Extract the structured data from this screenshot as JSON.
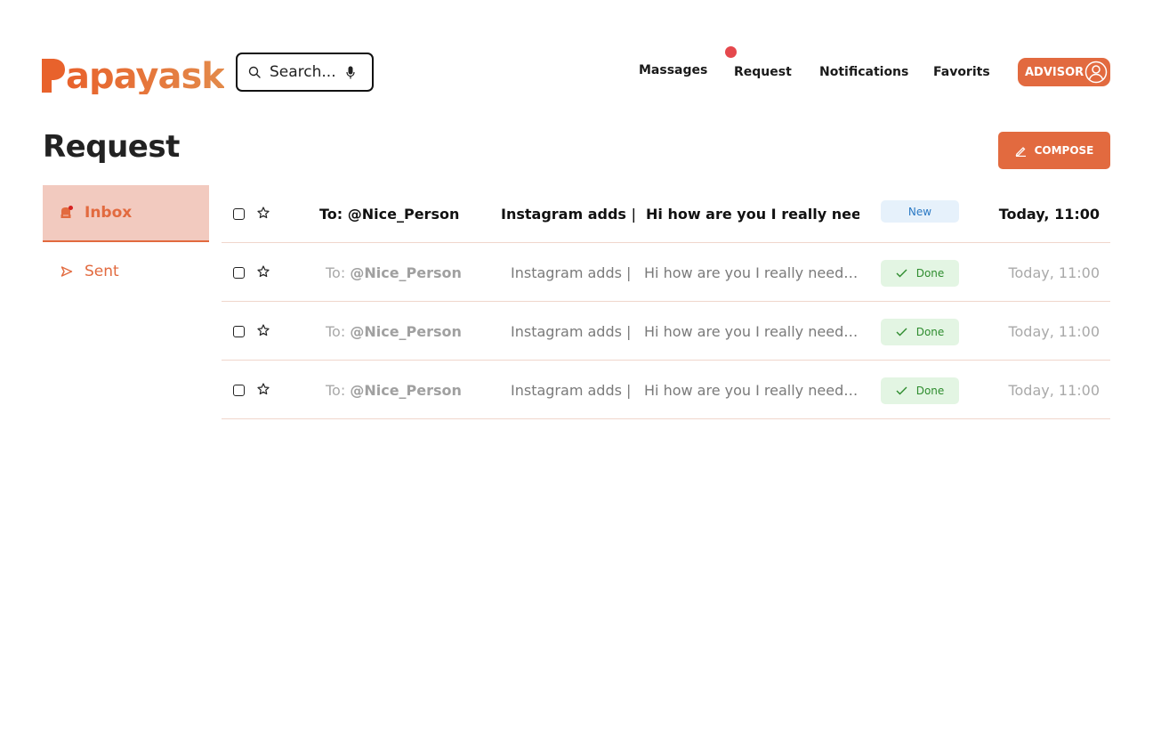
{
  "brand": {
    "logo_text": "apayask",
    "logo_initial": "P",
    "accent_color": "#e26a3f"
  },
  "search": {
    "placeholder": "Search...",
    "icon": "search-icon",
    "voice_icon": "microphone-icon"
  },
  "nav": {
    "items": [
      "Massages",
      "Request",
      "Notifications",
      "Favorits"
    ],
    "active_dot_color": "#e5484d"
  },
  "advisor_button": {
    "label": "ADVISOR",
    "icon": "user-circle-icon"
  },
  "page": {
    "title": "Request"
  },
  "compose_button": {
    "label": "COMPOSE",
    "icon": "pencil-icon"
  },
  "sidebar": {
    "items": [
      {
        "label": "Inbox",
        "icon": "inbox-icon",
        "active": true
      },
      {
        "label": "Sent",
        "icon": "send-icon",
        "active": false
      }
    ]
  },
  "rows": [
    {
      "to_prefix": "To:",
      "to_user": "@Nice_Person",
      "subject": "Instagram adds |",
      "preview": "Hi how are you I really need…",
      "status": "New",
      "time": "Today, 11:00",
      "unread": true
    },
    {
      "to_prefix": "To:",
      "to_user": "@Nice_Person",
      "subject": "Instagram adds |",
      "preview": "Hi how are you I really need…",
      "status": "Done",
      "time": "Today, 11:00",
      "unread": false
    },
    {
      "to_prefix": "To:",
      "to_user": "@Nice_Person",
      "subject": "Instagram adds |",
      "preview": "Hi how are you I really need…",
      "status": "Done",
      "time": "Today, 11:00",
      "unread": false
    },
    {
      "to_prefix": "To:",
      "to_user": "@Nice_Person",
      "subject": "Instagram adds |",
      "preview": "Hi how are you I really need…",
      "status": "Done",
      "time": "Today, 11:00",
      "unread": false
    }
  ]
}
